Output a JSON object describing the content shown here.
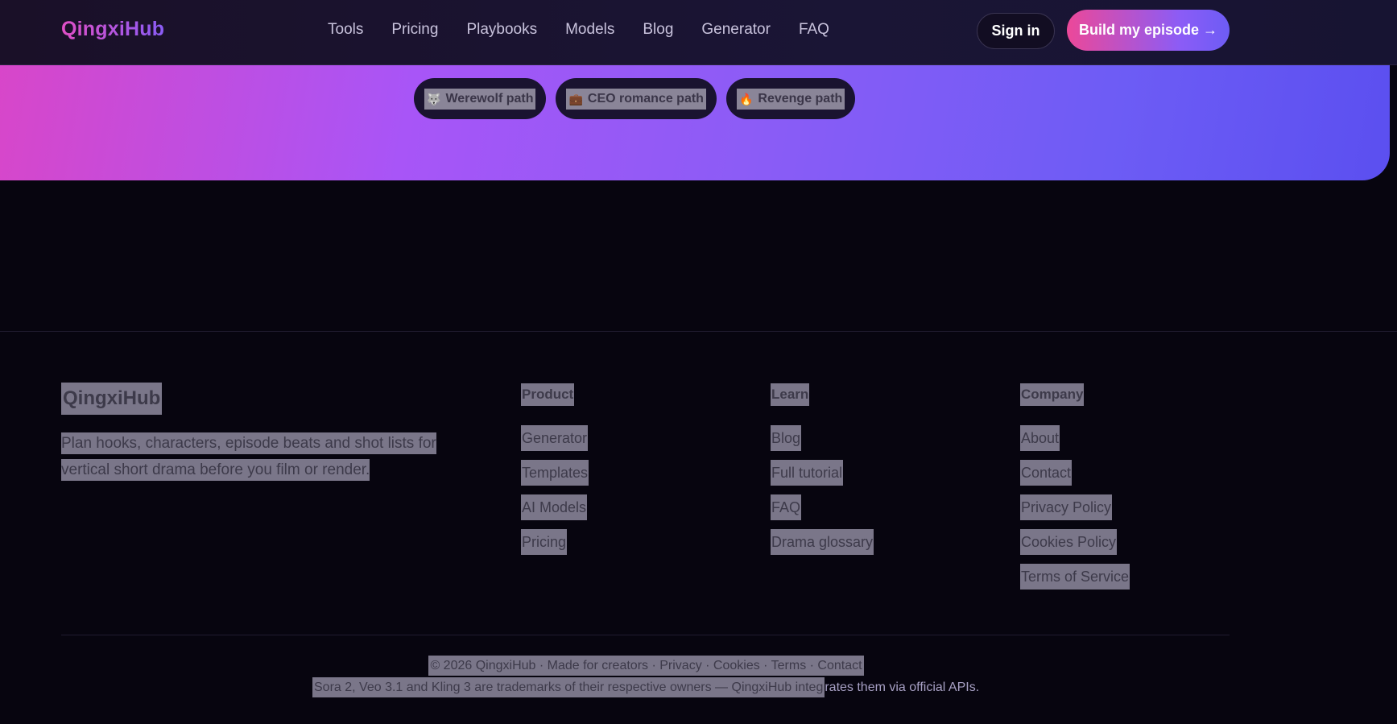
{
  "header": {
    "logo": "QingxiHub",
    "nav": [
      "Tools",
      "Pricing",
      "Playbooks",
      "Models",
      "Blog",
      "Generator",
      "FAQ"
    ],
    "signin": "Sign in",
    "cta": "Build my episode →"
  },
  "paths": [
    {
      "emoji": "🐺",
      "label": "Werewolf path"
    },
    {
      "emoji": "💼",
      "label": "CEO romance path"
    },
    {
      "emoji": "🔥",
      "label": "Revenge path"
    }
  ],
  "footer": {
    "brand": "QingxiHub",
    "description": "Plan hooks, characters, episode beats and shot lists for vertical short drama before you film or render.",
    "columns": [
      {
        "title": "Product",
        "items": [
          "Generator",
          "Templates",
          "AI Models",
          "Pricing"
        ]
      },
      {
        "title": "Learn",
        "items": [
          "Blog",
          "Full tutorial",
          "FAQ",
          "Drama glossary"
        ]
      },
      {
        "title": "Company",
        "items": [
          "About",
          "Contact",
          "Privacy Policy",
          "Cookies Policy",
          "Terms of Service"
        ]
      }
    ],
    "legal_line": "© 2026 QingxiHub · Made for creators · Privacy · Cookies · Terms · Contact",
    "trademark_part1": "Sora 2, Veo 3.1 and Kling 3 are trademarks of their respective owners — QingxiHub integ",
    "trademark_part2": "rates them via official APIs."
  },
  "colors": {
    "accent_pink": "#ec4899",
    "accent_violet": "#8b5cf6",
    "background": "#07050f"
  }
}
